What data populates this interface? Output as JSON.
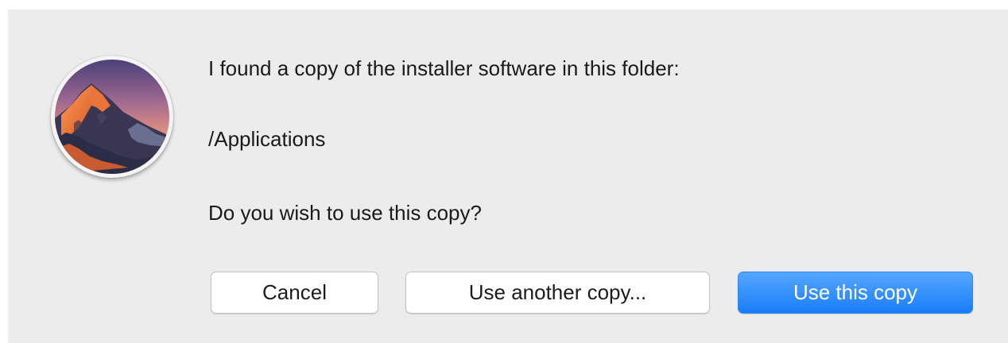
{
  "dialog": {
    "icon": "macos-sierra-installer-icon",
    "messages": {
      "found": "I found a copy of the installer software in this folder:",
      "path": "/Applications",
      "question": "Do you wish to use this copy?"
    },
    "buttons": {
      "cancel": "Cancel",
      "use_another": "Use another copy...",
      "use_this": "Use this copy"
    },
    "colors": {
      "background": "#ececec",
      "default_button": "#1a7df8",
      "text": "#1a1a1a"
    }
  }
}
